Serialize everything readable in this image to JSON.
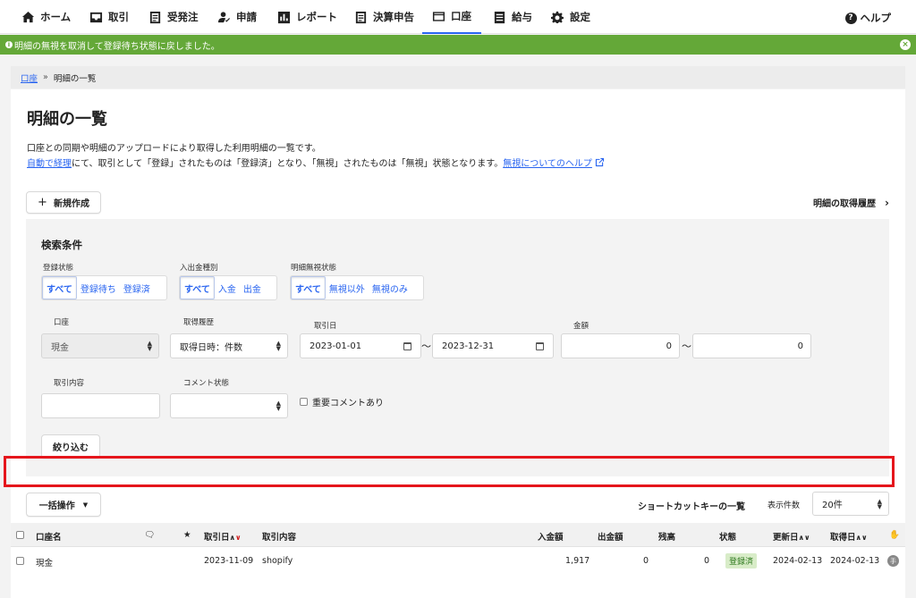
{
  "nav": {
    "items": [
      {
        "label": "ホーム",
        "icon": "home-icon"
      },
      {
        "label": "取引",
        "icon": "tray-icon"
      },
      {
        "label": "受発注",
        "icon": "document-icon"
      },
      {
        "label": "申請",
        "icon": "user-check-icon"
      },
      {
        "label": "レポート",
        "icon": "chart-icon"
      },
      {
        "label": "決算申告",
        "icon": "document-icon"
      },
      {
        "label": "口座",
        "icon": "card-icon"
      },
      {
        "label": "給与",
        "icon": "list-icon"
      },
      {
        "label": "設定",
        "icon": "gear-icon"
      }
    ],
    "help": "ヘルプ",
    "active_color": "#2864f0"
  },
  "flash": {
    "message": "明細の無視を取消して登録待ち状態に戻しました。",
    "color": "#64a838"
  },
  "breadcrumb": {
    "parent": "口座",
    "sep": "»",
    "current": "明細の一覧"
  },
  "page": {
    "title": "明細の一覧",
    "desc1": "口座との同期や明細のアップロードにより取得した利用明細の一覧です。",
    "desc2_link": "自動で経理",
    "desc2_text": "にて、取引として「登録」されたものは「登録済」となり、「無視」されたものは「無視」状態となります。",
    "desc2_help_link": "無視についてのヘルプ",
    "new_button": "新規作成",
    "history_link": "明細の取得履歴"
  },
  "search": {
    "title": "検索条件",
    "reg_status": {
      "label": "登録状態",
      "options": [
        "すべて",
        "登録待ち",
        "登録済"
      ]
    },
    "io_type": {
      "label": "入出金種別",
      "options": [
        "すべて",
        "入金",
        "出金"
      ]
    },
    "ignore_status": {
      "label": "明細無視状態",
      "options": [
        "すべて",
        "無視以外",
        "無視のみ"
      ]
    },
    "account": {
      "label": "口座",
      "value": "現金"
    },
    "fetch_history": {
      "label": "取得履歴",
      "value": "取得日時：件数"
    },
    "date": {
      "label": "取引日",
      "from": "2023-01-01",
      "to": "2023-12-31"
    },
    "amount": {
      "label": "金額",
      "from": "0",
      "to": "0"
    },
    "content": {
      "label": "取引内容",
      "value": ""
    },
    "comment": {
      "label": "コメント状態",
      "value": "",
      "important": "重要コメントあり"
    },
    "submit": "絞り込む",
    "tilde": "〜"
  },
  "table": {
    "bulk": "一括操作",
    "shortcut": "ショートカットキーの一覧",
    "perpage_label": "表示件数",
    "perpage_value": "20件",
    "headers": {
      "account": "口座名",
      "date": "取引日",
      "content": "取引内容",
      "deposit": "入金額",
      "withdraw": "出金額",
      "balance": "残高",
      "status": "状態",
      "updated": "更新日",
      "fetched": "取得日"
    },
    "rows": [
      {
        "account": "現金",
        "date": "2023-11-09",
        "content": "shopify",
        "deposit": "1,917",
        "withdraw": "0",
        "balance": "0",
        "status": "登録済",
        "updated": "2024-02-13",
        "fetched": "2024-02-13",
        "type_badge": "手"
      }
    ]
  }
}
